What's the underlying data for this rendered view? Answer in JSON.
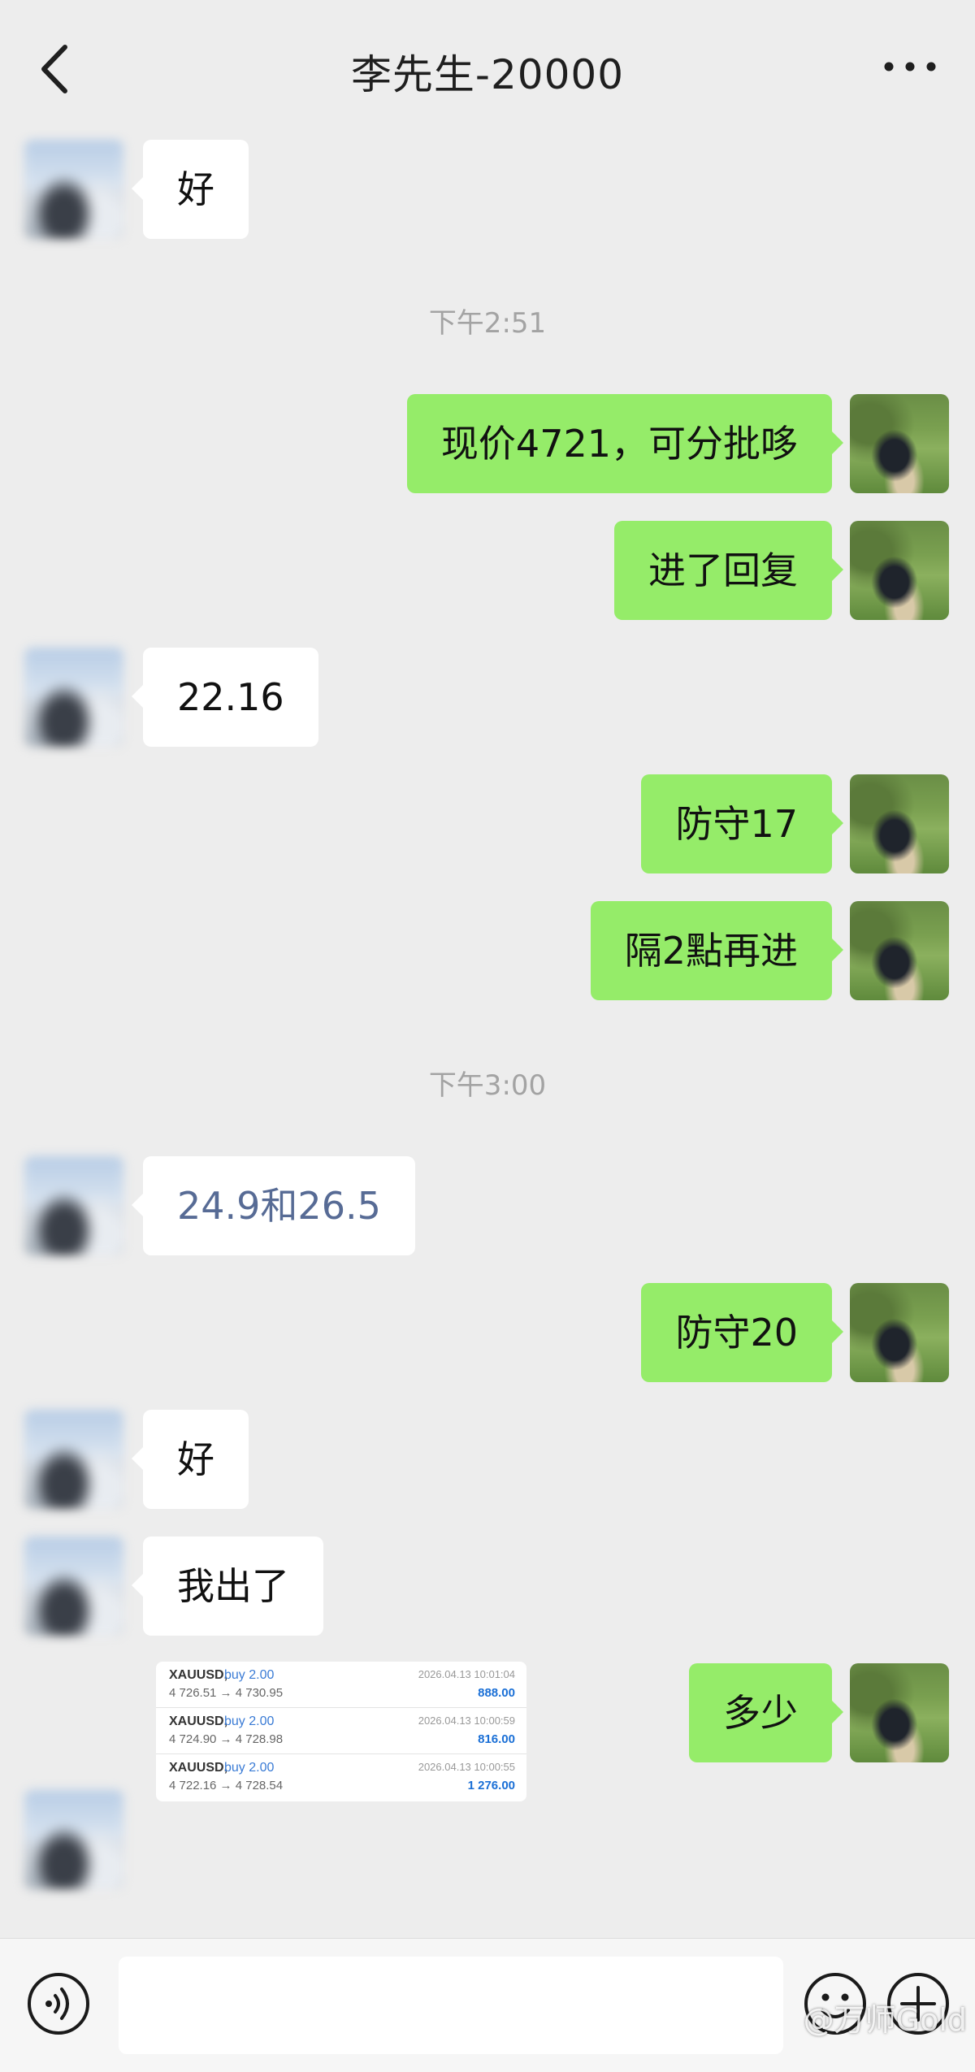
{
  "header": {
    "title": "李先生-20000",
    "back_icon": "chevron-left-icon",
    "more_icon": "more-dots-icon"
  },
  "timestamps": [
    "下午2:51",
    "下午3:00"
  ],
  "messages": [
    {
      "from": "contact",
      "text": "好"
    },
    {
      "from": "me",
      "text": "现价4721，可分批哆"
    },
    {
      "from": "me",
      "text": "进了回复"
    },
    {
      "from": "contact",
      "text": "22.16"
    },
    {
      "from": "me",
      "text": "防守17"
    },
    {
      "from": "me",
      "text": "隔2點再进"
    },
    {
      "from": "contact",
      "text": "24.9和26.5"
    },
    {
      "from": "me",
      "text": "防守20"
    },
    {
      "from": "contact",
      "text": "好"
    },
    {
      "from": "contact",
      "text": "我出了"
    },
    {
      "from": "me",
      "text": "多少"
    }
  ],
  "trade_card": {
    "rows": [
      {
        "symbol": "XAUUSD,",
        "direction": "buy 2.00",
        "prices": "4 726.51 → 4 730.95",
        "datetime": "2026.04.13 10:01:04",
        "profit": "888.00"
      },
      {
        "symbol": "XAUUSD,",
        "direction": "buy 2.00",
        "prices": "4 724.90 → 4 728.98",
        "datetime": "2026.04.13 10:00:59",
        "profit": "816.00"
      },
      {
        "symbol": "XAUUSD,",
        "direction": "buy 2.00",
        "prices": "4 722.16 → 4 728.54",
        "datetime": "2026.04.13 10:00:55",
        "profit": "1 276.00"
      }
    ]
  },
  "input_bar": {
    "voice_icon": "voice-icon",
    "emoji_icon": "emoji-icon",
    "plus_icon": "plus-icon",
    "placeholder": ""
  },
  "watermark": "@万师Gold",
  "colors": {
    "background": "#ededed",
    "my_bubble": "#95ec69",
    "contact_bubble": "#ffffff",
    "link_text": "#576b95",
    "timestamp_text": "#a3a3a3"
  }
}
